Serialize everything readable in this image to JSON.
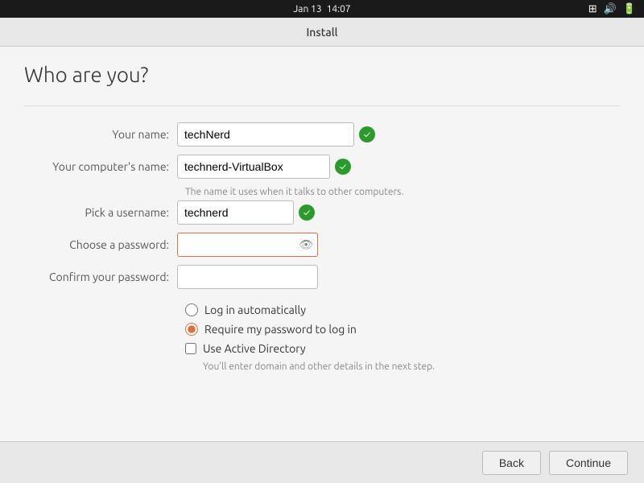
{
  "statusBar": {
    "date": "Jan 13",
    "time": "14:07"
  },
  "titleBar": {
    "title": "Install"
  },
  "pageTitle": "Who are you?",
  "form": {
    "yourNameLabel": "Your name:",
    "yourNameValue": "techNerd",
    "computerNameLabel": "Your computer's name:",
    "computerNameValue": "technerd-VirtualBox",
    "computerNameHint": "The name it uses when it talks to other computers.",
    "usernameLabel": "Pick a username:",
    "usernameValue": "technerd",
    "passwordLabel": "Choose a password:",
    "passwordValue": "",
    "confirmPasswordLabel": "Confirm your password:",
    "confirmPasswordValue": ""
  },
  "options": {
    "logInAutoLabel": "Log in automatically",
    "requirePasswordLabel": "Require my password to log in",
    "activeDirectoryLabel": "Use Active Directory",
    "activeDirectoryHint": "You'll enter domain and other details in the next step."
  },
  "buttons": {
    "back": "Back",
    "continue": "Continue"
  }
}
